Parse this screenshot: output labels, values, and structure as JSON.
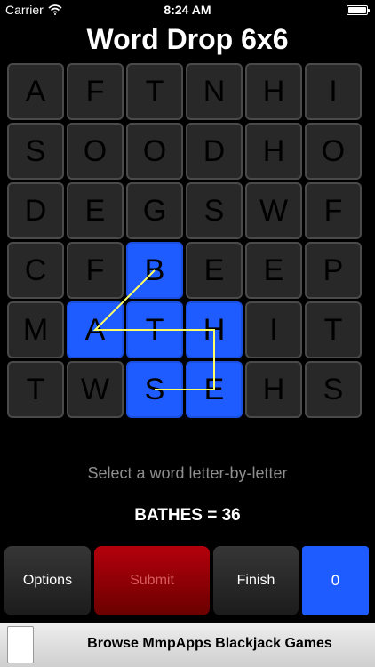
{
  "status_bar": {
    "carrier": "Carrier",
    "time": "8:24 AM"
  },
  "title": "Word Drop 6x6",
  "board": {
    "rows": [
      [
        "A",
        "F",
        "T",
        "N",
        "H",
        "I"
      ],
      [
        "S",
        "O",
        "O",
        "D",
        "H",
        "O"
      ],
      [
        "D",
        "E",
        "G",
        "S",
        "W",
        "F"
      ],
      [
        "C",
        "F",
        "B",
        "E",
        "E",
        "P"
      ],
      [
        "M",
        "A",
        "T",
        "H",
        "I",
        "T"
      ],
      [
        "T",
        "W",
        "S",
        "E",
        "H",
        "S"
      ]
    ],
    "selected_path": [
      [
        3,
        2
      ],
      [
        4,
        1
      ],
      [
        4,
        2
      ],
      [
        4,
        3
      ],
      [
        5,
        3
      ],
      [
        5,
        2
      ]
    ],
    "selected_color": "#1f5cff",
    "path_color": "#ffff66"
  },
  "hint": "Select a word letter-by-letter",
  "word_score": "BATHES = 36",
  "buttons": {
    "options": "Options",
    "submit": "Submit",
    "finish": "Finish",
    "score": "0"
  },
  "ad": {
    "text": "Browse MmpApps Blackjack Games"
  }
}
